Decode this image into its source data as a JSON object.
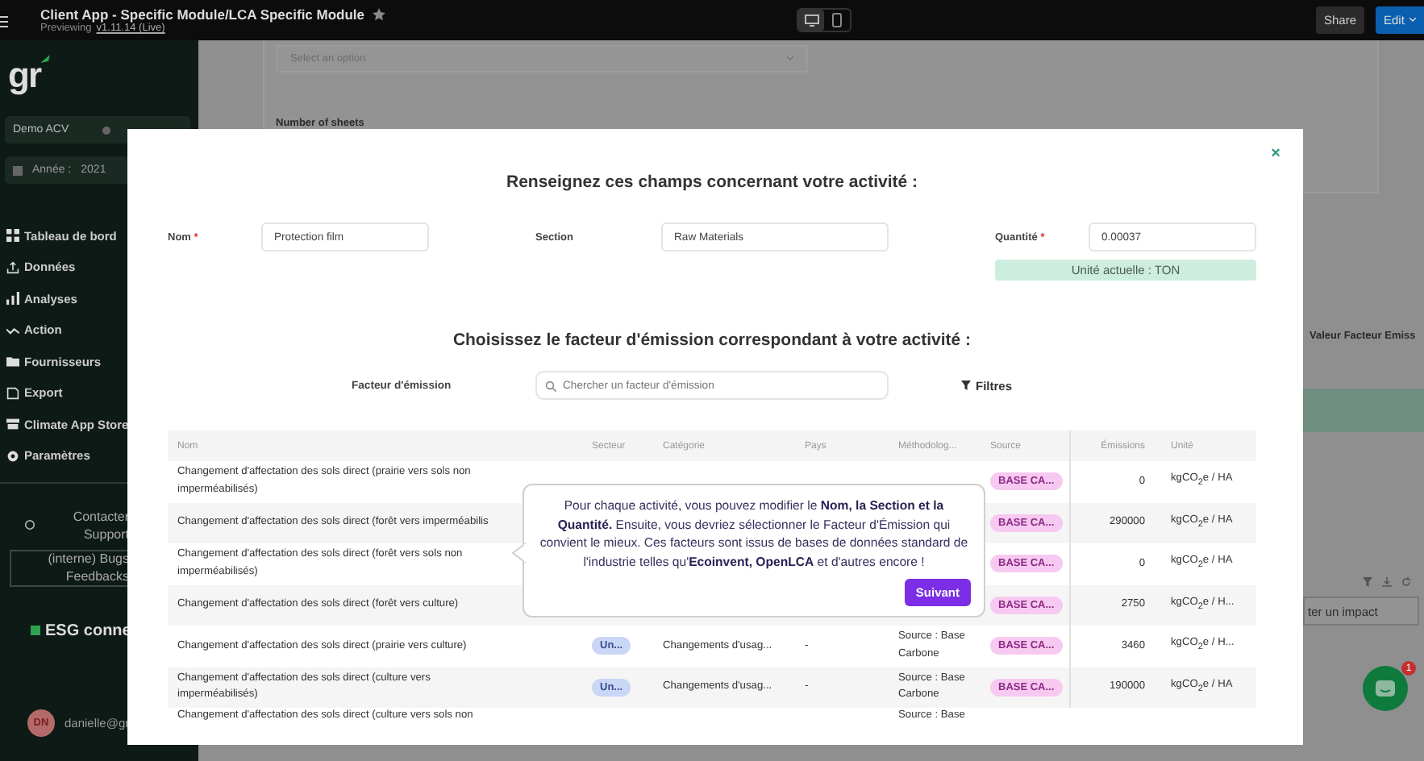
{
  "top_bar": {
    "title": "Client App - Specific Module/LCA Specific Module",
    "preview_label": "Previewing",
    "version": "v1.11.14 (Live)",
    "devices": [
      {
        "kind": "desktop",
        "selected": true
      },
      {
        "kind": "mobile",
        "selected": false
      }
    ],
    "share": "Share",
    "edit": "Edit"
  },
  "sidebar": {
    "logo": "gr",
    "org": "Demo ACV",
    "year_label": "Année :",
    "year": "2021",
    "nav": [
      {
        "kind": "grid",
        "label": "Tableau de bord"
      },
      {
        "kind": "upload",
        "label": "Données"
      },
      {
        "kind": "bars",
        "label": "Analyses"
      },
      {
        "kind": "trend",
        "label": "Action"
      },
      {
        "kind": "folder",
        "label": "Fournisseurs"
      },
      {
        "kind": "doc",
        "label": "Export"
      },
      {
        "kind": "store",
        "label": "Climate App Store"
      },
      {
        "kind": "gear",
        "label": "Paramètres"
      }
    ],
    "support": [
      "Contacter",
      "Support"
    ],
    "feedback": [
      "(interne) Bugs",
      "Feedbacks"
    ],
    "community": "ESG conne",
    "user": {
      "initials": "DN",
      "email": "danielle@gr"
    }
  },
  "background": {
    "select_placeholder": "Select an option",
    "sheets_label": "Number of sheets",
    "column_label": "Valeur Facteur Emiss",
    "impact_button": "ter un impact",
    "chat_badge": "1"
  },
  "modal": {
    "close": "×",
    "title": "Renseignez ces champs concernant votre activité :",
    "fields": [
      {
        "label": "Nom",
        "required_mark": "*",
        "value": "Protection film"
      },
      {
        "label": "Section",
        "value": "Raw Materials"
      },
      {
        "label": "Quantité",
        "required_mark": "*",
        "value": "0.00037"
      }
    ],
    "unit_note": "Unité actuelle : TON",
    "subtitle": "Choisissez le facteur d'émission correspondant à votre activité :",
    "search_label": "Facteur d'émission",
    "search_placeholder": "Chercher un facteur d'émission",
    "filters": "Filtres",
    "table": {
      "columns": [
        "Nom",
        "Secteur",
        "Catégorie",
        "Pays",
        "Méthodolog...",
        "Source",
        "Émissions",
        "Unité"
      ],
      "rows": [
        {
          "name": "Changement d'affectation des sols direct (prairie vers sols non imperméabilisés)",
          "source": "BASE CA...",
          "emissions": "0",
          "unit": "kgCO$_{2}$e / HA"
        },
        {
          "name": "Changement d'affectation des sols direct (forêt vers imperméabilis",
          "source": "BASE CA...",
          "emissions": "290000",
          "unit": "kgCO$_{2}$e / HA"
        },
        {
          "name": "Changement d'affectation des sols direct (forêt vers sols non imperméabilisés)",
          "source": "BASE CA...",
          "emissions": "0",
          "unit": "kgCO$_{2}$e / HA"
        },
        {
          "name": "Changement d'affectation des sols direct (forêt vers culture)",
          "source": "BASE CA...",
          "emissions": "2750",
          "unit": "kgCO$_{2}$e / H..."
        },
        {
          "name": "Changement d'affectation des sols direct (prairie vers culture)",
          "sector": "Un...",
          "category": "Changements d'usag...",
          "country": "-",
          "methodology": "Source : Base Carbone",
          "source": "BASE CA...",
          "emissions": "3460",
          "unit": "kgCO$_{2}$e / H..."
        },
        {
          "name": "Changement d'affectation des sols direct (culture vers imperméabilisés)",
          "sector": "Un...",
          "category": "Changements d'usag...",
          "country": "-",
          "methodology": "Source : Base Carbone",
          "source": "BASE CA...",
          "emissions": "190000",
          "unit": "kgCO$_{2}$e / HA"
        },
        {
          "name": "Changement d'affectation des sols direct (culture vers sols non",
          "methodology": "Source : Base"
        }
      ]
    },
    "tour": {
      "text": "Pour chaque activité, vous pouvez modifier le **Nom, la Section et la Quantité.** Ensuite, vous devriez sélectionner le Facteur d'Émission qui convient le mieux. Ces facteurs sont issus de bases de données standard de l'industrie telles qu'**Ecoinvent, OpenLCA** et d'autres encore !",
      "button": "Suivant"
    }
  }
}
